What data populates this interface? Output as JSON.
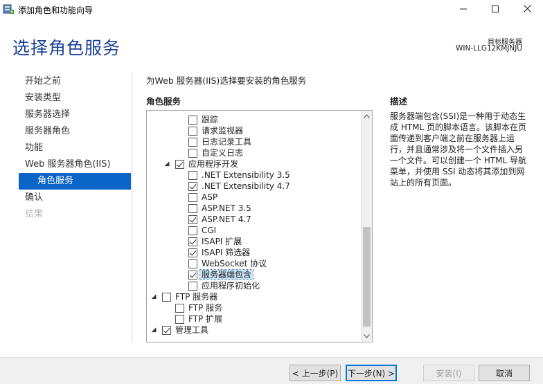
{
  "window": {
    "title": "添加角色和功能向导",
    "icon": "server-manager-icon",
    "controls": {
      "minimize": "minimize-icon",
      "maximize": "maximize-icon",
      "close": "close-icon"
    }
  },
  "header": {
    "page_title": "选择角色服务",
    "target_label": "目标服务器",
    "target_server": "WIN-LLG12KMJNJU"
  },
  "nav": {
    "items": [
      {
        "label": "开始之前",
        "state": "normal"
      },
      {
        "label": "安装类型",
        "state": "normal"
      },
      {
        "label": "服务器选择",
        "state": "normal"
      },
      {
        "label": "服务器角色",
        "state": "normal"
      },
      {
        "label": "功能",
        "state": "normal"
      },
      {
        "label": "Web 服务器角色(IIS)",
        "state": "normal"
      },
      {
        "label": "角色服务",
        "state": "active"
      },
      {
        "label": "确认",
        "state": "normal"
      },
      {
        "label": "结果",
        "state": "disabled"
      }
    ]
  },
  "main": {
    "instruction": "为Web 服务器(IIS)选择要安装的角色服务",
    "roles_heading": "角色服务",
    "tree": [
      {
        "label": "跟踪",
        "level": 2,
        "checked": false,
        "expander": ""
      },
      {
        "label": "请求监视器",
        "level": 2,
        "checked": false,
        "expander": ""
      },
      {
        "label": "日志记录工具",
        "level": 2,
        "checked": false,
        "expander": ""
      },
      {
        "label": "自定义日志",
        "level": 2,
        "checked": false,
        "expander": ""
      },
      {
        "label": "应用程序开发",
        "level": 1,
        "checked": true,
        "expander": "◢"
      },
      {
        "label": ".NET Extensibility 3.5",
        "level": 2,
        "checked": false,
        "expander": ""
      },
      {
        "label": ".NET Extensibility 4.7",
        "level": 2,
        "checked": true,
        "expander": ""
      },
      {
        "label": "ASP",
        "level": 2,
        "checked": false,
        "expander": ""
      },
      {
        "label": "ASP.NET 3.5",
        "level": 2,
        "checked": false,
        "expander": ""
      },
      {
        "label": "ASP.NET 4.7",
        "level": 2,
        "checked": true,
        "expander": ""
      },
      {
        "label": "CGI",
        "level": 2,
        "checked": false,
        "expander": ""
      },
      {
        "label": "ISAPI 扩展",
        "level": 2,
        "checked": true,
        "expander": ""
      },
      {
        "label": "ISAPI 筛选器",
        "level": 2,
        "checked": true,
        "expander": ""
      },
      {
        "label": "WebSocket 协议",
        "level": 2,
        "checked": false,
        "expander": ""
      },
      {
        "label": "服务器端包含",
        "level": 2,
        "checked": true,
        "expander": "",
        "selected": true
      },
      {
        "label": "应用程序初始化",
        "level": 2,
        "checked": false,
        "expander": ""
      },
      {
        "label": "FTP 服务器",
        "level": 0,
        "checked": false,
        "expander": "◢"
      },
      {
        "label": "FTP 服务",
        "level": 1,
        "checked": false,
        "expander": ""
      },
      {
        "label": "FTP 扩展",
        "level": 1,
        "checked": false,
        "expander": ""
      },
      {
        "label": "管理工具",
        "level": 0,
        "checked": true,
        "expander": "◢"
      }
    ]
  },
  "description": {
    "heading": "描述",
    "text": "服务器端包含(SSI)是一种用于动态生成 HTML 页的脚本语言。该脚本在页面传递到客户端之前在服务器上运行，并且通常涉及将一个文件插入另一个文件。可以创建一个 HTML 导航菜单，并使用 SSI 动态将其添加到网站上的所有页面。"
  },
  "footer": {
    "prev": "< 上一步(P)",
    "next": "下一步(N) >",
    "install": "安装(I)",
    "cancel": "取消"
  }
}
